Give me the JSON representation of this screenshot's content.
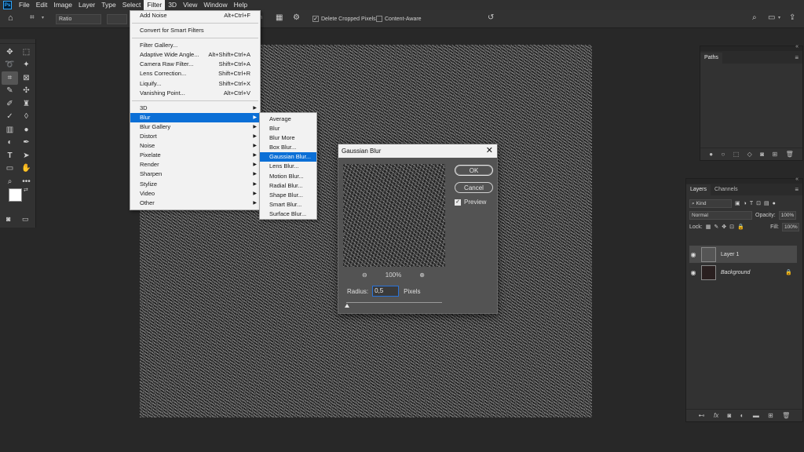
{
  "app": {
    "logo": "Ps",
    "menu": [
      "File",
      "Edit",
      "Image",
      "Layer",
      "Type",
      "Select",
      "Filter",
      "3D",
      "View",
      "Window",
      "Help"
    ]
  },
  "options": {
    "ratio": "Ratio",
    "delete_cropped": "Delete Cropped Pixels",
    "content_aware": "Content-Aware",
    "delete_cropped_checked": true,
    "content_aware_checked": false
  },
  "filter_menu": {
    "top": [
      {
        "label": "Add Noise",
        "shortcut": "Alt+Ctrl+F"
      }
    ],
    "smart": "Convert for Smart Filters",
    "gallery": [
      {
        "label": "Filter Gallery...",
        "shortcut": ""
      },
      {
        "label": "Adaptive Wide Angle...",
        "shortcut": "Alt+Shift+Ctrl+A"
      },
      {
        "label": "Camera Raw Filter...",
        "shortcut": "Shift+Ctrl+A"
      },
      {
        "label": "Lens Correction...",
        "shortcut": "Shift+Ctrl+R"
      },
      {
        "label": "Liquify...",
        "shortcut": "Shift+Ctrl+X"
      },
      {
        "label": "Vanishing Point...",
        "shortcut": "Alt+Ctrl+V"
      }
    ],
    "submenus": [
      "3D",
      "Blur",
      "Blur Gallery",
      "Distort",
      "Noise",
      "Pixelate",
      "Render",
      "Sharpen",
      "Stylize",
      "Video",
      "Other"
    ]
  },
  "blur_menu": [
    "Average",
    "Blur",
    "Blur More",
    "Box Blur...",
    "Gaussian Blur...",
    "Lens Blur...",
    "Motion Blur...",
    "Radial Blur...",
    "Shape Blur...",
    "Smart Blur...",
    "Surface Blur..."
  ],
  "dialog": {
    "title": "Gaussian Blur",
    "ok": "OK",
    "cancel": "Cancel",
    "preview": "Preview",
    "preview_checked": true,
    "zoom": "100%",
    "radius_label": "Radius:",
    "radius_value": "0,5",
    "radius_unit": "Pixels"
  },
  "paths_panel": {
    "tab": "Paths"
  },
  "layers_panel": {
    "tabs": [
      "Layers",
      "Channels"
    ],
    "kind": "Kind",
    "blend_mode": "Normal",
    "opacity_label": "Opacity:",
    "opacity_value": "100%",
    "lock_label": "Lock:",
    "fill_label": "Fill:",
    "fill_value": "100%",
    "layers": [
      {
        "name": "Layer 1"
      },
      {
        "name": "Background"
      }
    ]
  }
}
